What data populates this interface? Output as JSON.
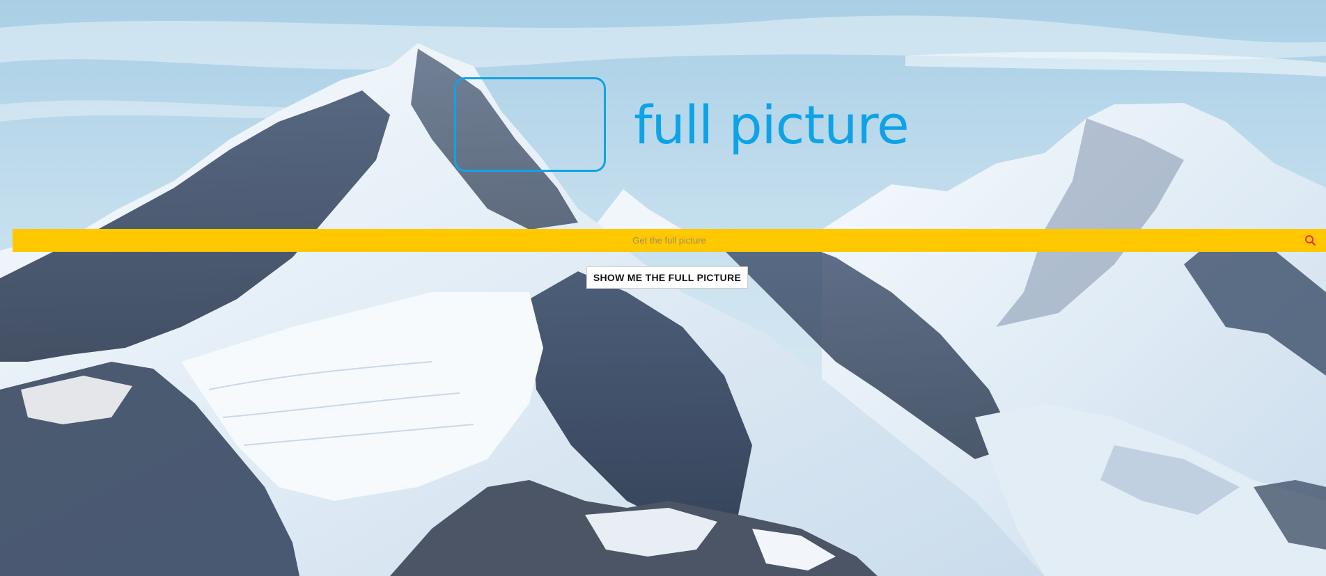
{
  "brand": {
    "name": "full picture",
    "color": "#0ea3e6"
  },
  "search": {
    "placeholder": "Get the full picture",
    "value": "",
    "bar_color": "#ffc800",
    "icon": "search-icon"
  },
  "cta": {
    "label": "SHOW ME THE FULL PICTURE"
  },
  "background": {
    "subject": "snow-mountains"
  }
}
